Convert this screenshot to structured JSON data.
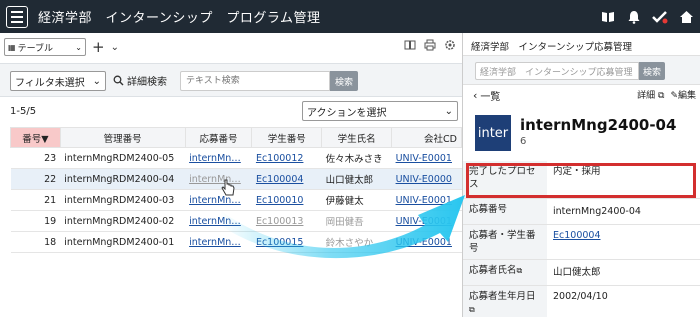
{
  "header": {
    "title": "経済学部　インターンシップ　プログラム管理",
    "bg_color": "#202a34"
  },
  "list_panel": {
    "view_select": "テーブル",
    "filter_select": "フィルタ未選択",
    "advanced_search": "詳細検索",
    "search_placeholder": "テキスト検索",
    "search_button": "検索",
    "record_count": "1-5/5",
    "action_select": "アクションを選択",
    "columns": [
      "番号▼",
      "管理番号",
      "応募番号",
      "学生番号",
      "学生氏名",
      "会社CD"
    ],
    "rows": [
      {
        "no": "23",
        "mgmt": "internMngRDM2400-05",
        "app": "internMn…",
        "student_no": "Ec100012",
        "name": "佐々木みさき",
        "company": "UNIV-E0001"
      },
      {
        "no": "22",
        "mgmt": "internMngRDM2400-04",
        "app": "internMn…",
        "student_no": "Ec100004",
        "name": "山口健太郎",
        "company": "UNIV-E0000"
      },
      {
        "no": "21",
        "mgmt": "internMngRDM2400-03",
        "app": "internMn…",
        "student_no": "Ec100010",
        "name": "伊藤健太",
        "company": "UNIV-E0001"
      },
      {
        "no": "19",
        "mgmt": "internMngRDM2400-02",
        "app": "internMn…",
        "student_no": "Ec100013",
        "name": "岡田健吾",
        "company": "UNIV-E0001"
      },
      {
        "no": "18",
        "mgmt": "internMngRDM2400-01",
        "app": "internMn…",
        "student_no": "Ec100015",
        "name": "鈴木さやか",
        "company": "UNIV-E0001"
      }
    ]
  },
  "detail_panel": {
    "title": "経済学部　インターンシップ応募管理",
    "search_placeholder": "経済学部　インターンシップ応募管理",
    "search_button": "検索",
    "back_label": "一覧",
    "detail_link": "詳細",
    "edit_link": "編集",
    "logo_text": "inter",
    "record_title": "internMng2400-04",
    "record_sub": "6",
    "fields": [
      {
        "label": "完了したプロセス",
        "value": "内定・採用"
      },
      {
        "label": "応募番号",
        "value": "internMng2400-04"
      },
      {
        "label": "応募者・学生番号",
        "value": "Ec100004"
      },
      {
        "label": "応募者氏名",
        "value": "山口健太郎"
      },
      {
        "label": "応募者生年月日",
        "value": "2002/04/10"
      }
    ]
  },
  "colors": {
    "highlight": "#d32e2e",
    "sorted_header": "#f8c9c9",
    "arrow": "#29c6ef"
  }
}
